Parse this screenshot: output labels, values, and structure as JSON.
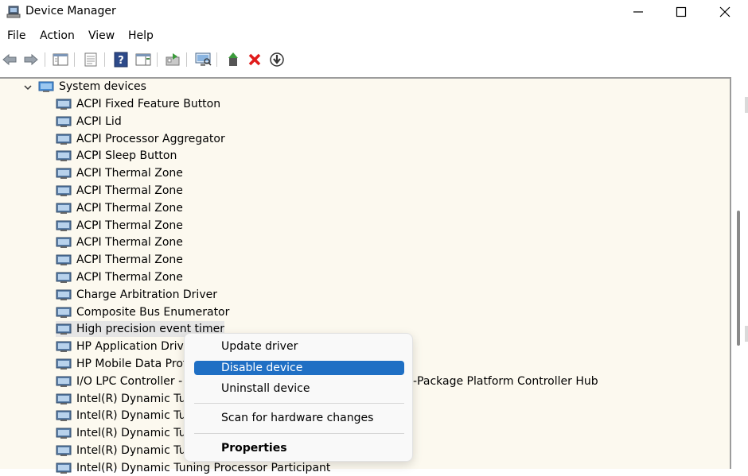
{
  "window": {
    "title": "Device Manager"
  },
  "menu": [
    "File",
    "Action",
    "View",
    "Help"
  ],
  "toolbar_icons": [
    "back-arrow-icon",
    "forward-arrow-icon",
    "show-hide-tree-icon",
    "properties-sheet-icon",
    "help-icon",
    "action-pane-icon",
    "update-driver-icon",
    "scan-hardware-icon",
    "enable-device-icon",
    "uninstall-device-icon",
    "download-driver-icon"
  ],
  "tree": {
    "category": "System devices",
    "items": [
      "ACPI Fixed Feature Button",
      "ACPI Lid",
      "ACPI Processor Aggregator",
      "ACPI Sleep Button",
      "ACPI Thermal Zone",
      "ACPI Thermal Zone",
      "ACPI Thermal Zone",
      "ACPI Thermal Zone",
      "ACPI Thermal Zone",
      "ACPI Thermal Zone",
      "ACPI Thermal Zone",
      "Charge Arbitration Driver",
      "Composite Bus Enumerator",
      "High precision event timer",
      "HP Application Drive",
      "HP Mobile Data Prote",
      "I/O LPC Controller - S",
      "Intel(R) Dynamic Tun",
      "Intel(R) Dynamic Tun",
      "Intel(R) Dynamic Tun",
      "Intel(R) Dynamic Tun",
      "Intel(R) Dynamic Tuning Processor Participant"
    ],
    "lpc_suffix": "-Package Platform Controller Hub"
  },
  "context_menu": {
    "update": "Update driver",
    "disable": "Disable device",
    "uninstall": "Uninstall device",
    "scan": "Scan for hardware changes",
    "properties": "Properties"
  },
  "colors": {
    "highlight": "#1f6fc4",
    "tree_bg": "#fcf9ef"
  }
}
